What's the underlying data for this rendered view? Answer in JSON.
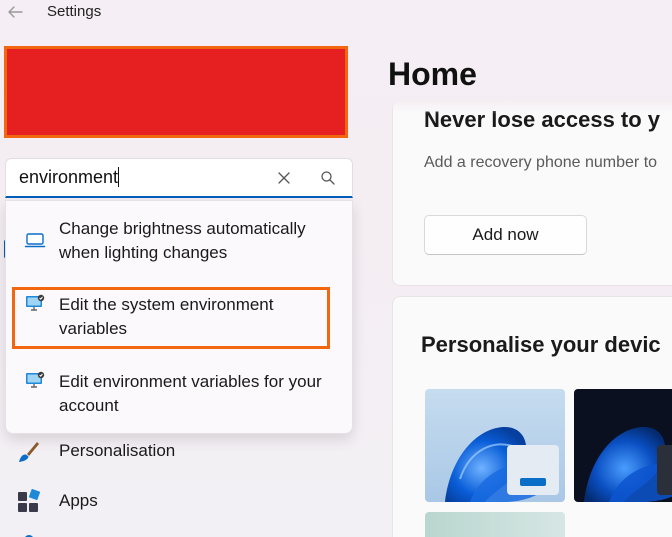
{
  "window": {
    "title": "Settings"
  },
  "search": {
    "value": "environment",
    "results": [
      {
        "label": "Change brightness automatically when lighting changes",
        "icon": "laptop-icon"
      },
      {
        "label": "Edit the system environment variables",
        "icon": "monitor-settings-icon"
      },
      {
        "label": "Edit environment variables for your account",
        "icon": "monitor-settings-icon"
      }
    ]
  },
  "sidebar": {
    "items": [
      {
        "label": "Personalisation",
        "icon": "paintbrush-icon"
      },
      {
        "label": "Apps",
        "icon": "apps-icon"
      }
    ]
  },
  "main": {
    "title": "Home",
    "account_card": {
      "title": "Never lose access to y",
      "text": "Add a recovery phone number to",
      "button": "Add now"
    },
    "personalise_card": {
      "title": "Personalise your devic"
    }
  },
  "colors": {
    "accent": "#005fb8",
    "highlight": "#f2660f",
    "redaction": "#e62020"
  }
}
